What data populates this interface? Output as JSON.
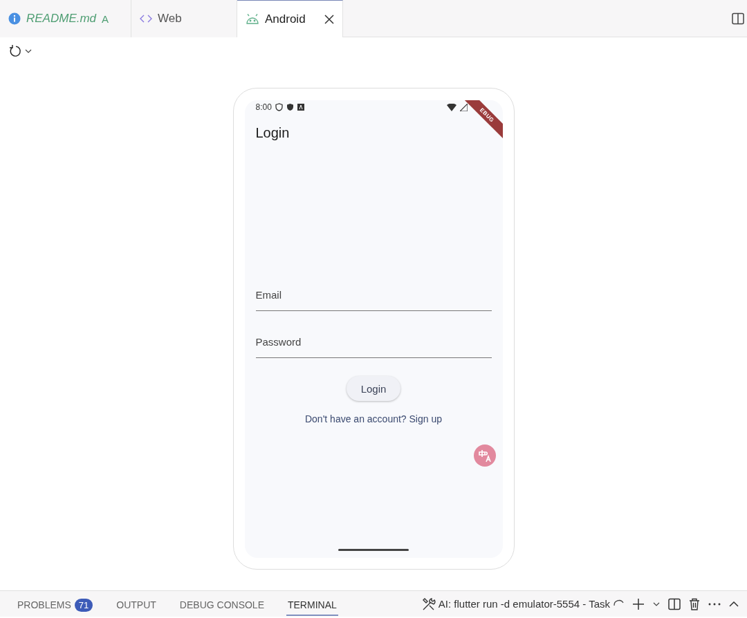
{
  "tabs": [
    {
      "label": "README.md",
      "kind": "info",
      "badge": "A",
      "selected": false
    },
    {
      "label": "Web",
      "kind": "code",
      "selected": false
    },
    {
      "label": "Android",
      "kind": "android",
      "selected": true
    }
  ],
  "phone": {
    "status_time": "8:00",
    "debug_banner": "EBUG",
    "app_title": "Login",
    "fields": [
      {
        "placeholder": "Email"
      },
      {
        "placeholder": "Password"
      }
    ],
    "button": "Login",
    "link": "Don't have an account? Sign up"
  },
  "panel_tabs": [
    {
      "label": "PROBLEMS",
      "badge": "71",
      "selected": false
    },
    {
      "label": "OUTPUT",
      "selected": false
    },
    {
      "label": "DEBUG CONSOLE",
      "selected": false
    },
    {
      "label": "TERMINAL",
      "selected": true
    }
  ],
  "task": "AI: flutter run -d emulator-5554 - Task"
}
